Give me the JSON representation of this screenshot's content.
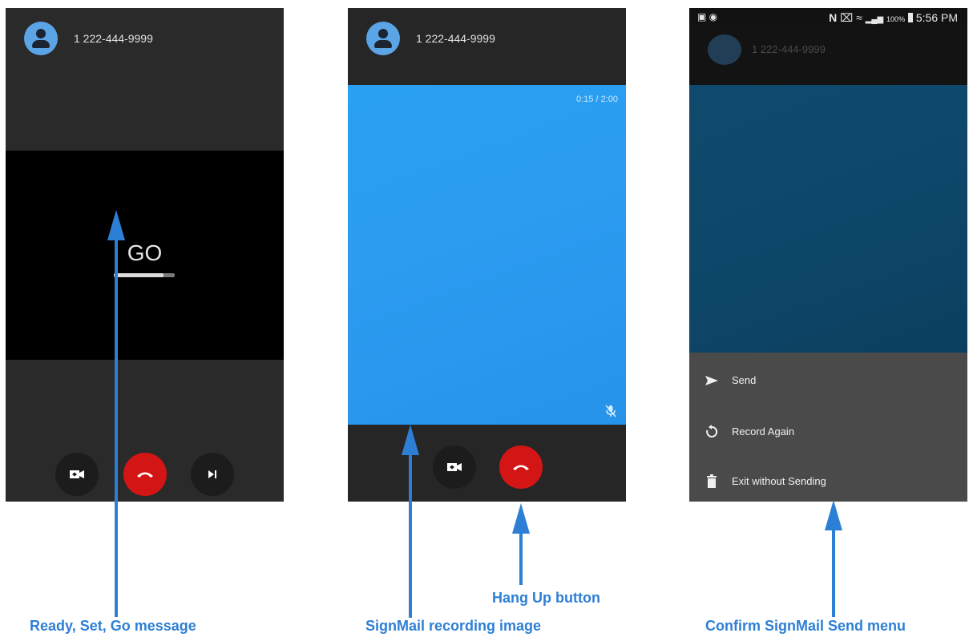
{
  "screens": [
    {
      "phone_number": "1 222-444-9999",
      "go_text": "GO",
      "countdown_progress": 0.82,
      "buttons": [
        "video-switch-icon",
        "hang-up-icon",
        "skip-icon"
      ]
    },
    {
      "phone_number": "1 222-444-9999",
      "timer": "0:15 / 2:00",
      "buttons": [
        "video-switch-icon",
        "hang-up-icon"
      ]
    },
    {
      "status_time": "5:56 PM",
      "battery": "100%",
      "phone_number": "1 222-444-9999",
      "menu": [
        {
          "label": "Send",
          "icon": "send-icon"
        },
        {
          "label": "Record Again",
          "icon": "record-again-icon"
        },
        {
          "label": "Exit without Sending",
          "icon": "trash-icon"
        }
      ]
    }
  ],
  "captions": {
    "ready": "Ready, Set, Go message",
    "recording": "SignMail recording image",
    "hangup": "Hang Up button",
    "confirm": "Confirm SignMail Send menu"
  },
  "colors": {
    "accent": "#2d7fd6",
    "hangup": "#d41515",
    "recording": "#2b9bf0"
  }
}
